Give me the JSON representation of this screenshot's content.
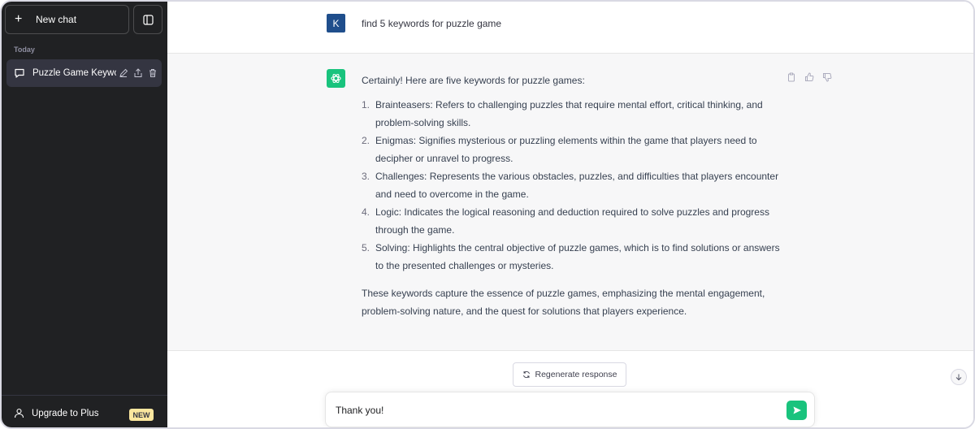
{
  "sidebar": {
    "new_chat_label": "New chat",
    "section_label": "Today",
    "chat_items": [
      {
        "title": "Puzzle Game Keywords"
      }
    ],
    "footer_label": "Upgrade to Plus",
    "footer_badge": "NEW"
  },
  "conversation": {
    "user_avatar_letter": "K",
    "user_message": "find 5 keywords for puzzle game",
    "assistant_intro": "Certainly! Here are five keywords for puzzle games:",
    "assistant_list": [
      {
        "num": "1.",
        "text": "Brainteasers: Refers to challenging puzzles that require mental effort, critical thinking, and problem-solving skills."
      },
      {
        "num": "2.",
        "text": "Enigmas: Signifies mysterious or puzzling elements within the game that players need to decipher or unravel to progress."
      },
      {
        "num": "3.",
        "text": "Challenges: Represents the various obstacles, puzzles, and difficulties that players encounter and need to overcome in the game."
      },
      {
        "num": "4.",
        "text": "Logic: Indicates the logical reasoning and deduction required to solve puzzles and progress through the game."
      },
      {
        "num": "5.",
        "text": "Solving: Highlights the central objective of puzzle games, which is to find solutions or answers to the presented challenges or mysteries."
      }
    ],
    "assistant_outro": "These keywords capture the essence of puzzle games, emphasizing the mental engagement, problem-solving nature, and the quest for solutions that players experience."
  },
  "regenerate_label": "Regenerate response",
  "composer": {
    "value": "Thank you!"
  },
  "colors": {
    "sidebar_bg": "#202123",
    "accent": "#19c37d",
    "user_avatar": "#1f4e8c",
    "badge": "#fae69e"
  },
  "icons": [
    "plus-icon",
    "sidebar-toggle-icon",
    "chat-bubble-icon",
    "edit-icon",
    "share-icon",
    "trash-icon",
    "user-icon",
    "openai-logo-icon",
    "copy-icon",
    "thumbs-up-icon",
    "thumbs-down-icon",
    "refresh-icon",
    "arrow-down-icon",
    "send-icon"
  ]
}
